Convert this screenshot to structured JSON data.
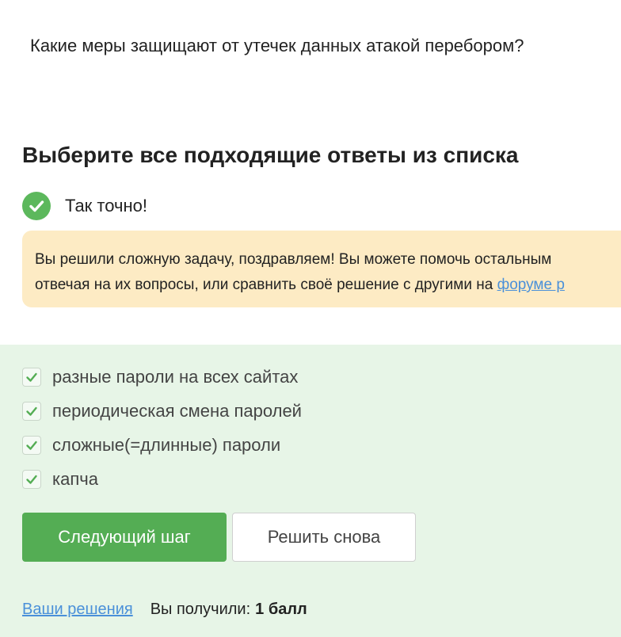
{
  "question": {
    "text": "Какие меры защищают от утечек данных атакой перебором?"
  },
  "section": {
    "title": "Выберите все подходящие ответы из списка"
  },
  "result": {
    "correct_text": "Так точно!",
    "icon": "check-circle-icon",
    "icon_color": "#5cb85c"
  },
  "notice": {
    "line1": "Вы решили сложную задачу, поздравляем! Вы можете помочь остальным",
    "line2_prefix": "отвечая на их вопросы, или сравнить своё решение с другими на ",
    "line2_link": "форуме р",
    "background": "#fdebc4"
  },
  "answers": {
    "background": "#e7f5e7",
    "options": [
      {
        "label": "разные пароли на всех сайтах",
        "checked": true
      },
      {
        "label": "периодическая смена паролей",
        "checked": true
      },
      {
        "label": "сложные(=длинные) пароли",
        "checked": true
      },
      {
        "label": "капча",
        "checked": true
      }
    ]
  },
  "buttons": {
    "next_label": "Следующий шаг",
    "retry_label": "Решить снова",
    "next_color": "#54ad54"
  },
  "footer": {
    "solutions_link": "Ваши решения",
    "score_label": "Вы получили:",
    "score_value": "1 балл"
  }
}
